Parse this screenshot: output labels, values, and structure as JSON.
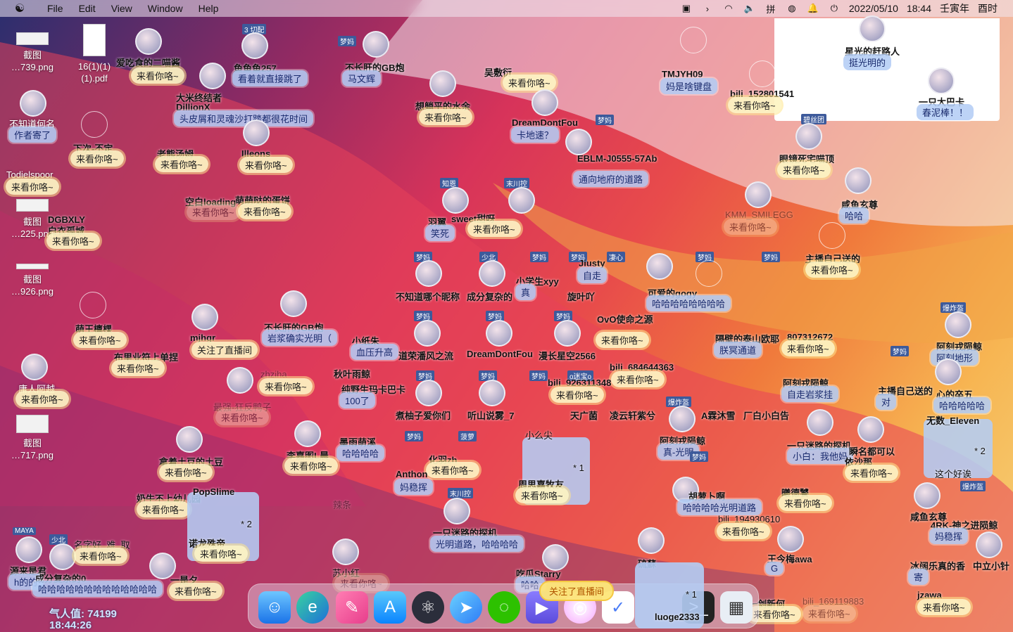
{
  "menubar": {
    "menus": [
      "File",
      "Edit",
      "View",
      "Window",
      "Help"
    ],
    "date": "2022/05/10",
    "time": "18:44",
    "lunar": "壬寅年",
    "hour_branch": "酉时",
    "input_method": "拼"
  },
  "desktop_icons": [
    {
      "label": "截图",
      "sub": "…739.png"
    },
    {
      "label": "16(1)(1)",
      "sub": "(1).pdf"
    },
    {
      "label": "截图",
      "sub": "…225.png"
    },
    {
      "label": "截图",
      "sub": "…926.png"
    },
    {
      "label": "截图",
      "sub": "…717.png"
    }
  ],
  "danmaku": [
    {
      "name": "爱吃食的二喵酱",
      "msg": "来看你咯~"
    },
    {
      "name": "鱼鱼鱼257",
      "msg": "看着就直接跳了"
    },
    {
      "name": "不长肝的GB炮",
      "msg": "马文辉"
    },
    {
      "name": "大米终结者",
      "msg": ""
    },
    {
      "name": "DillionX",
      "msg": "头皮屑和灵魂沙打踏都很花时间"
    },
    {
      "name": "想躺平的水余",
      "msg": "来看你咯~"
    },
    {
      "name": "吴敷衍",
      "msg": "来看你咯~"
    },
    {
      "name": "TMJYH09",
      "msg": "妈是啥键盘"
    },
    {
      "name": "bili_152801541",
      "msg": "来看你咯~"
    },
    {
      "name": "DreamDontFou",
      "msg": "卡地速？"
    },
    {
      "name": "EBLM-J0555-57Ab",
      "msg": "通向地府的道路"
    },
    {
      "name": "不知道何名",
      "msg": "作者寄了"
    },
    {
      "name": "下次-丕定",
      "msg": "来看你咯~"
    },
    {
      "name": "老熊汤姆",
      "msg": "来看你咯~"
    },
    {
      "name": "Illeons",
      "msg": "来看你咯~"
    },
    {
      "name": "Todielspoor",
      "msg": "来看你咯~"
    },
    {
      "name": "萌萌哒的蛋饼",
      "msg": "来看你咯~"
    },
    {
      "name": "空白loading",
      "msg": "来看你咯~"
    },
    {
      "name": "DGBXLY",
      "msg": ""
    },
    {
      "name": "白衣孤城",
      "msg": "来看你咯~"
    },
    {
      "name": "羽翼",
      "msg": "笑死"
    },
    {
      "name": "sweet甜呀",
      "msg": "来看你咯~"
    },
    {
      "name": "咸鱼玄尊",
      "msg": "哈哈"
    },
    {
      "name": "KMM_SMILEGG",
      "msg": "来看你咯~"
    },
    {
      "name": "主播自己送的",
      "msg": "来看你咯~"
    },
    {
      "name": "眼镜死宅喵顶",
      "msg": "来看你咯~"
    },
    {
      "name": "星光的赶路人",
      "msg": "挺光明的"
    },
    {
      "name": "一只大巴卡",
      "msg": "春泥棒！！"
    },
    {
      "name": "不知道哪个昵称",
      "msg": ""
    },
    {
      "name": "成分复杂的",
      "msg": ""
    },
    {
      "name": "小学生xyy",
      "msg": "真"
    },
    {
      "name": "Jiusty",
      "msg": "自走"
    },
    {
      "name": "旋叶吖",
      "msg": ""
    },
    {
      "name": "可爱的gogy",
      "msg": "哈哈哈哈哈哈哈哈"
    },
    {
      "name": "萌王檩棵",
      "msg": "来看你咯~"
    },
    {
      "name": "mjhgr",
      "msg": "关注了直播间"
    },
    {
      "name": "不长肝的GB炮",
      "msg": "岩浆确实光明（"
    },
    {
      "name": "小纸朱",
      "msg": "血压升高"
    },
    {
      "name": "布里业符上单捏",
      "msg": "来看你咯~"
    },
    {
      "name": "道荣潘风之流",
      "msg": ""
    },
    {
      "name": "DreamDontFou",
      "msg": ""
    },
    {
      "name": "漫长星空2566",
      "msg": ""
    },
    {
      "name": "OvO使命之源",
      "msg": "来看你咯~"
    },
    {
      "name": "隔壁的泰山欧耶",
      "msg": "朕冥通道"
    },
    {
      "name": "807312672",
      "msg": "来看你咯~"
    },
    {
      "name": "阿刻戎陨鲸",
      "msg": "阿刻地形"
    },
    {
      "name": "庸人阿越",
      "msg": "来看你咯~"
    },
    {
      "name": "zhziha",
      "msg": "来看你咯~"
    },
    {
      "name": "秋叶雨鲸",
      "msg": ""
    },
    {
      "name": "纯野生玛卡巴卡",
      "msg": "100了"
    },
    {
      "name": "bili_684644363",
      "msg": "来看你咯~"
    },
    {
      "name": "bili_926311348",
      "msg": "来看你咯~"
    },
    {
      "name": "阿刻戎陨鲸",
      "msg": "自走岩浆挂"
    },
    {
      "name": "主播自己送的",
      "msg": "对"
    },
    {
      "name": "心的卒五",
      "msg": "哈哈哈哈哈"
    },
    {
      "name": "最强-狂反鸭子",
      "msg": "来看你咯~"
    },
    {
      "name": "煮柚子爱你们",
      "msg": ""
    },
    {
      "name": "听山说雾_7",
      "msg": ""
    },
    {
      "name": "天广菌",
      "msg": ""
    },
    {
      "name": "凌云轩紫兮",
      "msg": ""
    },
    {
      "name": "A霖沐雪",
      "msg": ""
    },
    {
      "name": "厂白小白告",
      "msg": ""
    },
    {
      "name": "李嘉图L晨",
      "msg": "来看你咯~"
    },
    {
      "name": "墨雨萌溪",
      "msg": "哈哈哈哈"
    },
    {
      "name": "拿着土豆的土豆",
      "msg": "来看你咯~"
    },
    {
      "name": "化羽zh",
      "msg": "来看你咯~"
    },
    {
      "name": "Anthon",
      "msg": "妈稳挥"
    },
    {
      "name": "阿刻戎陨鲸",
      "msg": "真-光明"
    },
    {
      "name": "一只迷路的探机",
      "msg": "小白：我他妈"
    },
    {
      "name": "瞬名都可以",
      "msg": ""
    },
    {
      "name": "依沙那",
      "msg": "来看你咯~"
    },
    {
      "name": "无数_Eleven",
      "msg": "这个好诶"
    },
    {
      "name": "奶牛不上幼儿园",
      "msg": "来看你咯~"
    },
    {
      "name": "PopSlime",
      "msg": ""
    },
    {
      "name": "诺龙殊帝",
      "msg": "来看你咯~"
    },
    {
      "name": "周思嘉牧友",
      "msg": "来看你咯~"
    },
    {
      "name": "一只迷路的探机",
      "msg": "光明道路，哈哈哈哈"
    },
    {
      "name": "胡萝卜啊",
      "msg": "哈哈哈哈光明道路"
    },
    {
      "name": "曦德饕",
      "msg": "来看你咯~"
    },
    {
      "name": "bili_194930610",
      "msg": "来看你咯~"
    },
    {
      "name": "咸鱼玄尊",
      "msg": ""
    },
    {
      "name": "4RK-神之进陨鲸",
      "msg": "妈稳挥"
    },
    {
      "name": "名字好_难_取",
      "msg": "来看你咯~"
    },
    {
      "name": "源来是君",
      "msg": "h的的"
    },
    {
      "name": "成分复杂的0",
      "msg": "哈哈哈哈哈哈哈哈哈哈哈哈哈"
    },
    {
      "name": "一是夕",
      "msg": "来看你咯~"
    },
    {
      "name": "苏小红",
      "msg": "来看你咯~"
    },
    {
      "name": "吃瓜Starry",
      "msg": "哈哈"
    },
    {
      "name": "硫蘇",
      "msg": ""
    },
    {
      "name": "王今梅awa",
      "msg": "G"
    },
    {
      "name": "一剑新何",
      "msg": "来看你咯~"
    },
    {
      "name": "bili_169119883",
      "msg": "来看你咯~"
    },
    {
      "name": "冰阔乐真的香",
      "msg": "寄"
    },
    {
      "name": "中立小针",
      "msg": ""
    },
    {
      "name": "jzawa",
      "msg": "来看你咯~"
    },
    {
      "name": "luoge2333",
      "msg": "来看你咯~"
    },
    {
      "name": "辣条",
      "msg": ""
    }
  ],
  "follow_tip": "关注了直播间",
  "popularity": "气人值: 74199",
  "popularity_time": "18:44:26",
  "dock_apps": [
    "finder-icon",
    "edge-icon",
    "nova-icon",
    "appstore-icon",
    "electron-icon",
    "feishu-icon",
    "wechat-icon",
    "infuse-icon",
    "motion-icon",
    "ticktick-icon",
    "iterm-icon",
    "preview-icon"
  ],
  "badges": [
    "梦妈",
    "末川控",
    "知恩",
    "少北",
    "凄心",
    "3 切配",
    "碧丝团",
    "爆炸盔",
    "o迷宝o",
    "菠萝",
    "MAYA"
  ],
  "bubble_numbers": [
    "* 2",
    "* 1"
  ]
}
